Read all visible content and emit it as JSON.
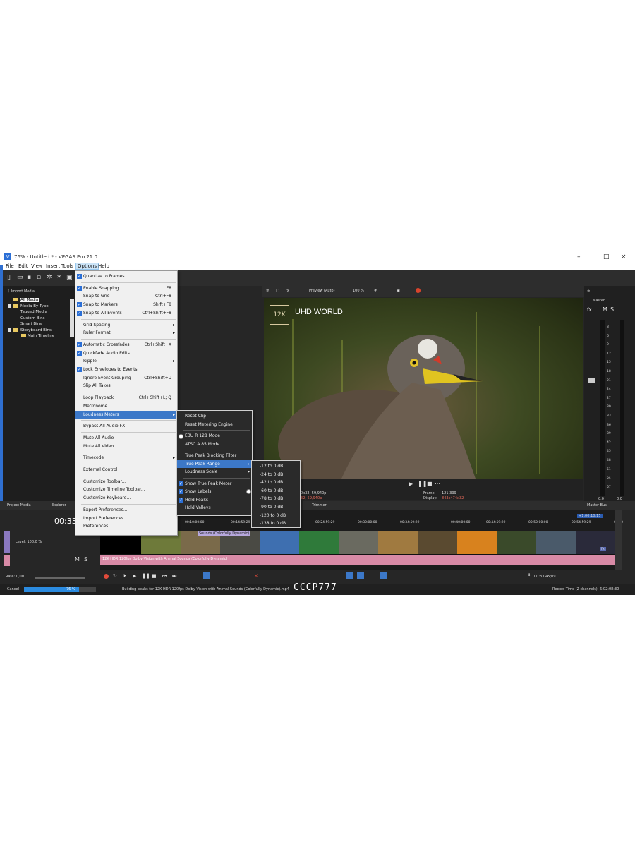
{
  "window": {
    "title": "76% - Untitled * - VEGAS Pro 21.0",
    "controls": [
      "–",
      "□",
      "×"
    ]
  },
  "menubar": [
    "File",
    "Edit",
    "View",
    "Insert",
    "Tools",
    "Options",
    "Help"
  ],
  "project_media": {
    "import_label": "Import Media...",
    "tree": [
      {
        "label": "All Media",
        "level": 0
      },
      {
        "label": "Media By Type",
        "level": 0
      },
      {
        "label": "Tagged Media",
        "level": 0
      },
      {
        "label": "Custom Bins",
        "level": 0
      },
      {
        "label": "Smart Bins",
        "level": 0
      },
      {
        "label": "Storyboard Bins",
        "level": 0
      },
      {
        "label": "Main Timeline",
        "level": 1
      }
    ],
    "tabs": [
      "Project Media",
      "Explorer"
    ]
  },
  "preview": {
    "mode": "Preview (Auto)",
    "zoom": "100 %",
    "logo": "12K",
    "watermark": "UHD WORLD",
    "info_left_1": "0x32; 59,940p",
    "info_left_2": "32; 59,940p",
    "frame_label": "Frame:",
    "frame_value": "121 399",
    "display_label": "Display:",
    "display_value": "843x474x32",
    "tab": "Trimmer"
  },
  "master": {
    "label": "Master",
    "fx": "fx",
    "m": "M",
    "s": "S",
    "scale": [
      "3",
      "6",
      "9",
      "12",
      "15",
      "18",
      "21",
      "24",
      "27",
      "30",
      "33",
      "36",
      "39",
      "42",
      "45",
      "48",
      "51",
      "54",
      "57"
    ],
    "readouts": [
      "0.0",
      "0.0"
    ],
    "bus_label": "Master Bus"
  },
  "timeline": {
    "timecode": "00:33",
    "level": "Level: 100,0 %",
    "rate": "Rate: 0,00",
    "m": "M",
    "s": "S",
    "ruler": [
      "00:10:00:00",
      "00:14:59:29",
      "00:24:59:29",
      "00:30:00:00",
      "00:34:59:29",
      "00:40:00:00",
      "00:44:59:29",
      "00:50:00:00",
      "00:54:59:29",
      "01:00"
    ],
    "marker": "+1:00:10:15",
    "video_clip": "Sounds (Colorfully Dynamic)",
    "audio_clip": "12K HDR 120fps Dolby Vision with Animal Sounds (Colorfully Dynamic)",
    "transport_time": "00:33:45;09",
    "fx_badge": "fx"
  },
  "status": {
    "cancel": "Cancel",
    "progress_text": "76 %",
    "progress": 0.76,
    "message": "Building peaks for 12K HDR 120fps Dolby Vision with Animal Sounds (Colorfully Dynamic).mp4",
    "watermark": "CCCP777",
    "record_time": "Record Time (2 channels): 6:02:08:30"
  },
  "options_menu": [
    {
      "label": "Quantize to Frames",
      "check": true,
      "shortcut": "",
      "sub": false
    },
    {
      "sep": true
    },
    {
      "label": "Enable Snapping",
      "check": true,
      "shortcut": "F8",
      "sub": false
    },
    {
      "label": "Snap to Grid",
      "check": false,
      "shortcut": "Ctrl+F8",
      "sub": false
    },
    {
      "label": "Snap to Markers",
      "check": true,
      "shortcut": "Shift+F8",
      "sub": false
    },
    {
      "label": "Snap to All Events",
      "check": true,
      "shortcut": "Ctrl+Shift+F8",
      "sub": false
    },
    {
      "sep": true
    },
    {
      "label": "Grid Spacing",
      "check": false,
      "shortcut": "",
      "sub": true
    },
    {
      "label": "Ruler Format",
      "check": false,
      "shortcut": "",
      "sub": true
    },
    {
      "sep": true
    },
    {
      "label": "Automatic Crossfades",
      "check": true,
      "shortcut": "Ctrl+Shift+X",
      "sub": false
    },
    {
      "label": "Quickfade Audio Edits",
      "check": true,
      "shortcut": "",
      "sub": false
    },
    {
      "label": "Ripple",
      "check": false,
      "shortcut": "",
      "sub": true
    },
    {
      "label": "Lock Envelopes to Events",
      "check": true,
      "shortcut": "",
      "sub": false
    },
    {
      "label": "Ignore Event Grouping",
      "check": false,
      "shortcut": "Ctrl+Shift+U",
      "sub": false
    },
    {
      "label": "Slip All Takes",
      "check": false,
      "shortcut": "",
      "sub": false
    },
    {
      "sep": true
    },
    {
      "label": "Loop Playback",
      "check": false,
      "shortcut": "Ctrl+Shift+L; Q",
      "sub": false
    },
    {
      "label": "Metronome",
      "check": false,
      "shortcut": "",
      "sub": false
    },
    {
      "label": "Loudness Meters",
      "check": false,
      "shortcut": "",
      "sub": true,
      "hl": true
    },
    {
      "sep": true
    },
    {
      "label": "Bypass All Audio FX",
      "check": false,
      "shortcut": "",
      "sub": false
    },
    {
      "sep": true
    },
    {
      "label": "Mute All Audio",
      "check": false,
      "shortcut": "",
      "sub": false
    },
    {
      "label": "Mute All Video",
      "check": false,
      "shortcut": "",
      "sub": false
    },
    {
      "sep": true
    },
    {
      "label": "Timecode",
      "check": false,
      "shortcut": "",
      "sub": true
    },
    {
      "sep": true
    },
    {
      "label": "External Control",
      "check": false,
      "shortcut": "",
      "sub": false
    },
    {
      "sep": true
    },
    {
      "label": "Customize Toolbar...",
      "check": false,
      "shortcut": "",
      "sub": false
    },
    {
      "label": "Customize Timeline Toolbar...",
      "check": false,
      "shortcut": "",
      "sub": false
    },
    {
      "label": "Customize Keyboard...",
      "check": false,
      "shortcut": "",
      "sub": false
    },
    {
      "sep": true
    },
    {
      "label": "Export Preferences...",
      "check": false,
      "shortcut": "",
      "sub": false
    },
    {
      "label": "Import Preferences...",
      "check": false,
      "shortcut": "",
      "sub": false
    },
    {
      "label": "Preferences...",
      "check": false,
      "shortcut": "",
      "sub": false
    }
  ],
  "loudness_menu": [
    {
      "label": "Reset Clip",
      "mark": "none",
      "sub": false
    },
    {
      "label": "Reset Metering Engine",
      "mark": "none",
      "sub": false
    },
    {
      "sep": true
    },
    {
      "label": "EBU R 128 Mode",
      "mark": "radio",
      "sub": false
    },
    {
      "label": "ATSC A 85 Mode",
      "mark": "none",
      "sub": false
    },
    {
      "sep": true
    },
    {
      "label": "True Peak Blocking Filter",
      "mark": "none",
      "sub": false
    },
    {
      "label": "True Peak Range",
      "mark": "none",
      "sub": true,
      "hl": true
    },
    {
      "label": "Loudness Scale",
      "mark": "none",
      "sub": true
    },
    {
      "sep": true
    },
    {
      "label": "Show True Peak Meter",
      "mark": "check",
      "sub": false
    },
    {
      "label": "Show Labels",
      "mark": "check",
      "sub": false
    },
    {
      "label": "Hold Peaks",
      "mark": "check",
      "sub": false
    },
    {
      "label": "Hold Valleys",
      "mark": "none",
      "sub": false
    }
  ],
  "range_menu": [
    {
      "label": "-12 to 0 dB",
      "selected": false
    },
    {
      "label": "-24 to 0 dB",
      "selected": false
    },
    {
      "label": "-42 to 0 dB",
      "selected": false
    },
    {
      "label": "-60 to 0 dB",
      "selected": true
    },
    {
      "label": "-78 to 0 dB",
      "selected": false
    },
    {
      "label": "-90 to 0 dB",
      "selected": false
    },
    {
      "label": "-120 to 0 dB",
      "selected": false
    },
    {
      "label": "-138 to 0 dB",
      "selected": false
    }
  ],
  "colors": {
    "accent": "#3c78c8",
    "video_track": "#b6a7dc",
    "audio_track": "#d88aa6",
    "progress": "#2b8be0"
  }
}
